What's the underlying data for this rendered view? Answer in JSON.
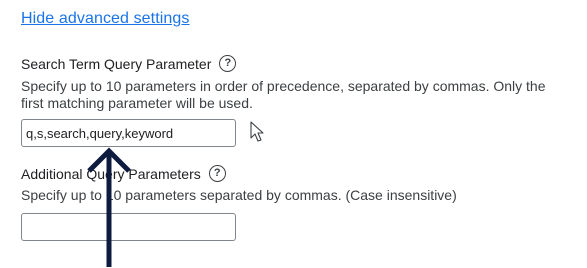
{
  "advanced_toggle": {
    "label": "Hide advanced settings"
  },
  "search_term": {
    "label": "Search Term Query Parameter",
    "help_icon": "help-circle-icon",
    "description_line1": "Specify up to 10 parameters in order of precedence, separated by commas. Only the",
    "description_line2": "first matching parameter will be used.",
    "value": "q,s,search,query,keyword"
  },
  "additional_query": {
    "label": "Additional Query Parameters",
    "help_icon": "help-circle-icon",
    "description": "Specify up to 10 parameters separated by commas. (Case insensitive)",
    "value": ""
  },
  "annotation": {
    "icon": "up-arrow-icon",
    "color": "#0d1b3e"
  },
  "pointer": {
    "icon": "mouse-pointer-icon"
  }
}
